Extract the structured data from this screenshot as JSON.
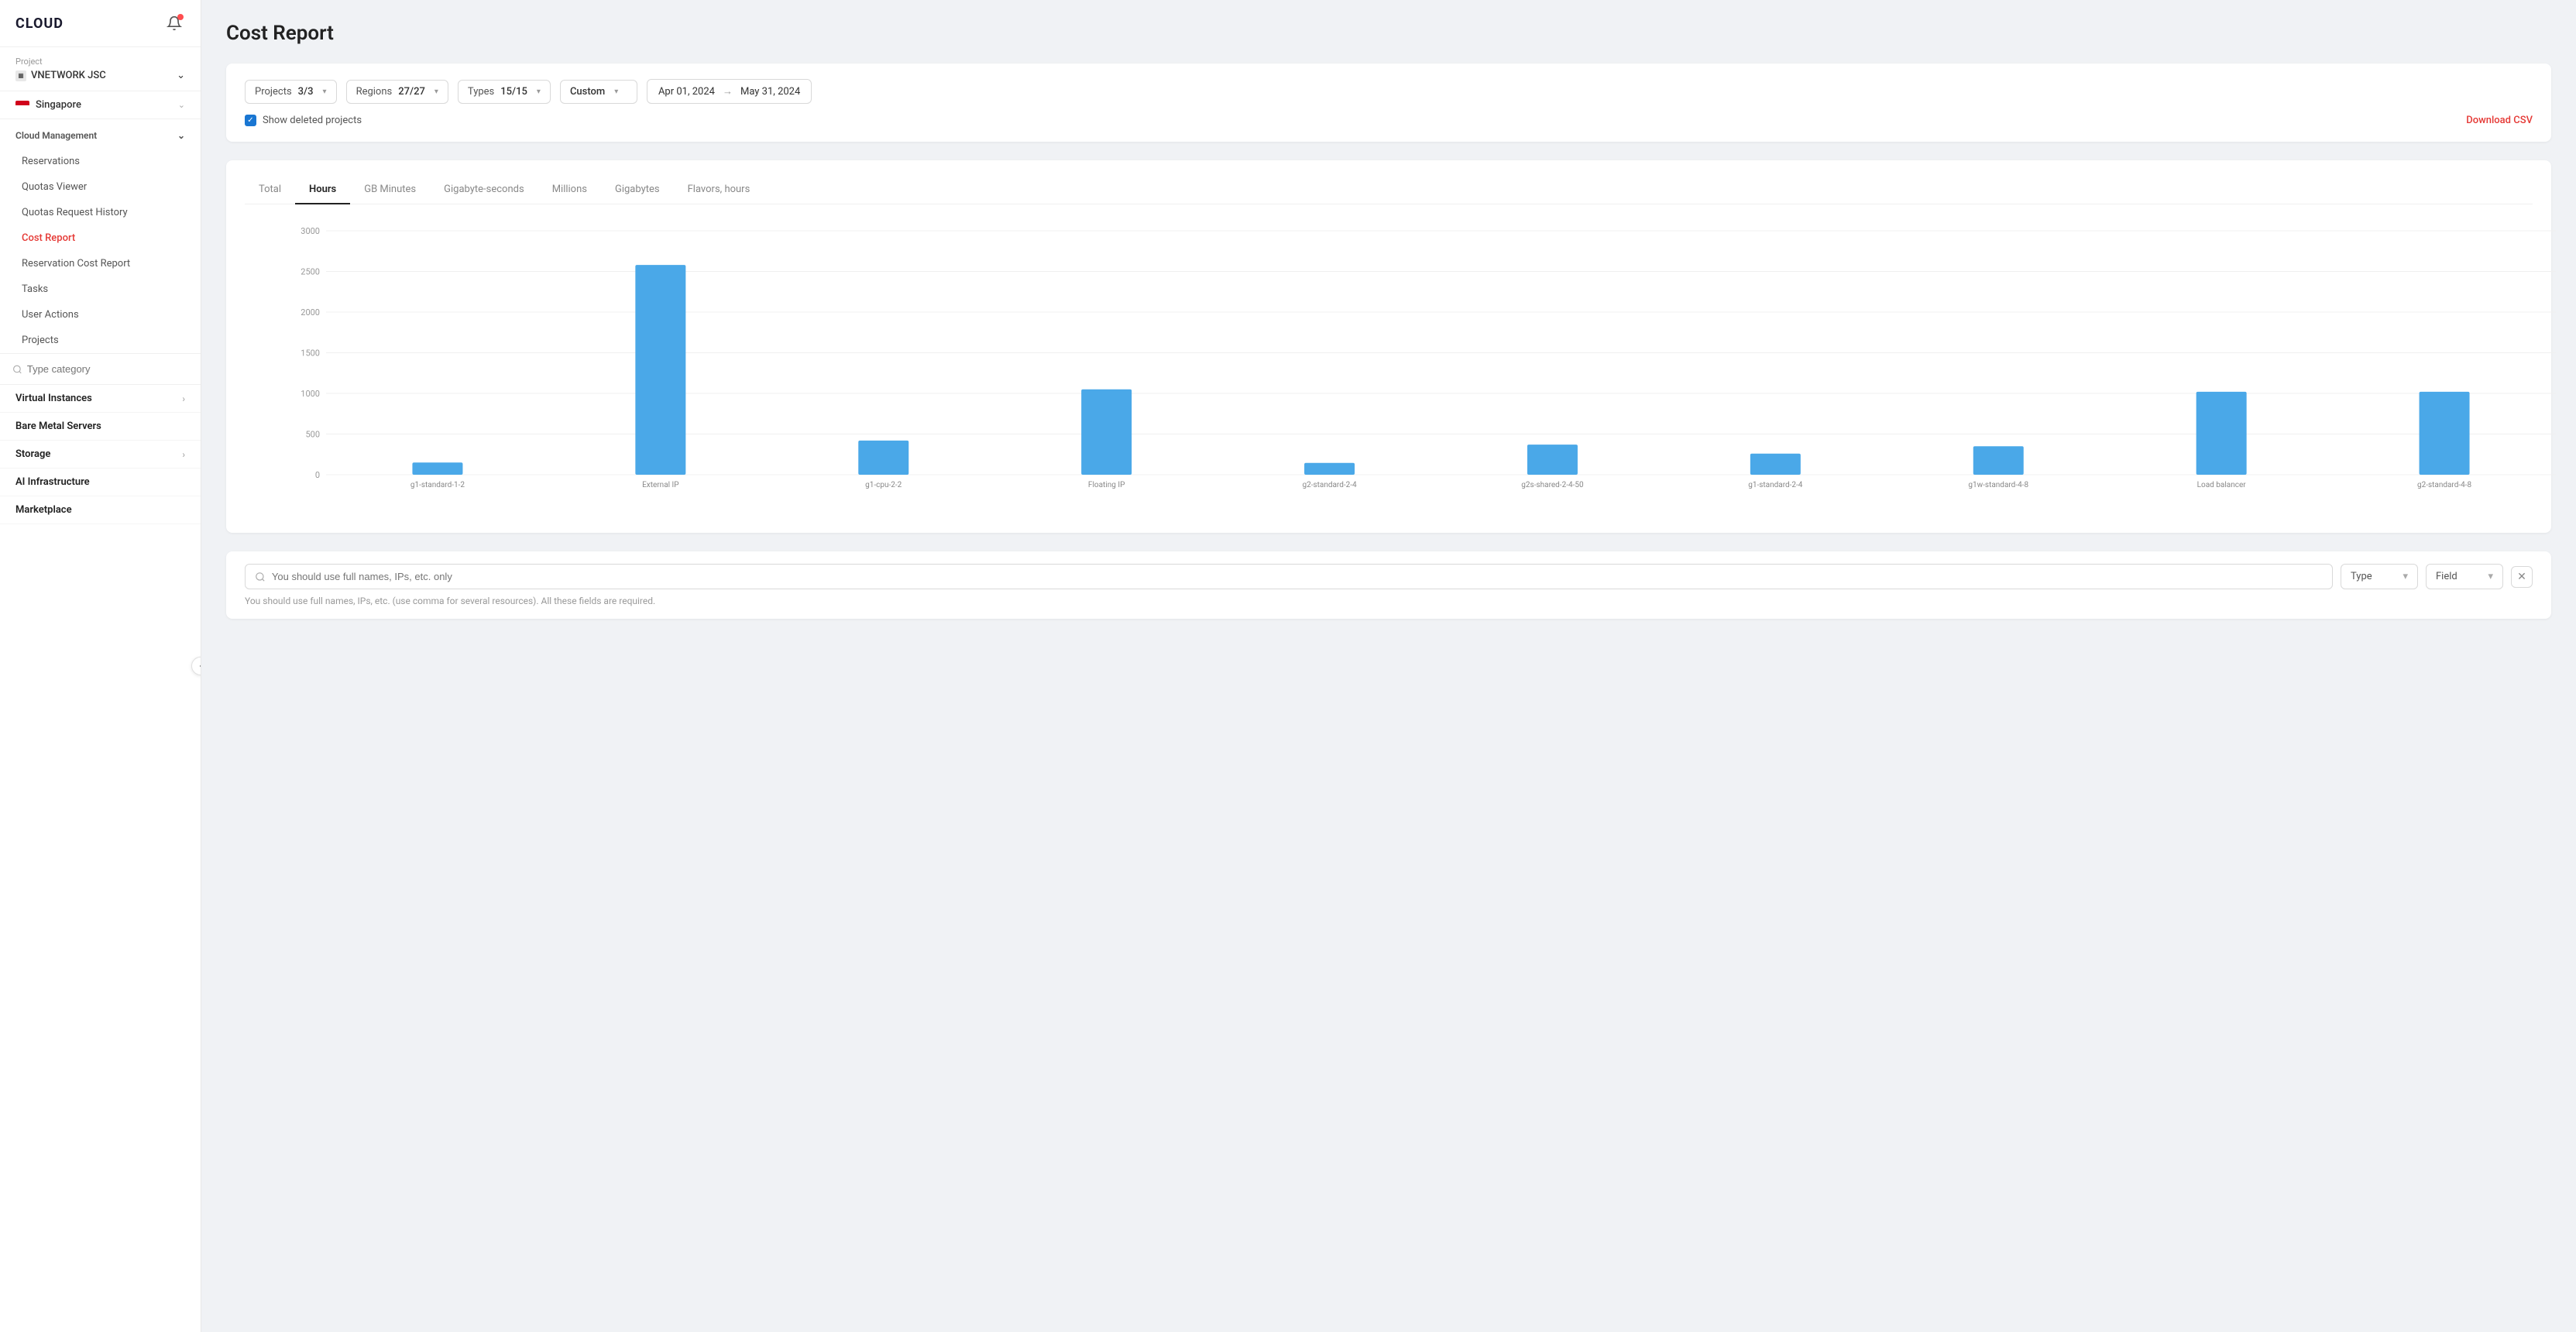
{
  "app": {
    "name": "CLOUD"
  },
  "sidebar": {
    "project_label": "Project",
    "project_name": "VNETWORK JSC",
    "region_name": "Singapore",
    "cloud_management_label": "Cloud Management",
    "nav_items": [
      {
        "id": "reservations",
        "label": "Reservations"
      },
      {
        "id": "quotas-viewer",
        "label": "Quotas Viewer"
      },
      {
        "id": "quotas-request-history",
        "label": "Quotas Request History"
      },
      {
        "id": "cost-report",
        "label": "Cost Report",
        "active": true
      },
      {
        "id": "reservation-cost-report",
        "label": "Reservation Cost Report"
      },
      {
        "id": "tasks",
        "label": "Tasks"
      },
      {
        "id": "user-actions",
        "label": "User Actions"
      },
      {
        "id": "projects",
        "label": "Projects"
      }
    ],
    "search_placeholder": "Type category",
    "categories": [
      {
        "id": "virtual-instances",
        "label": "Virtual Instances",
        "has_children": true
      },
      {
        "id": "bare-metal-servers",
        "label": "Bare Metal Servers",
        "has_children": false
      },
      {
        "id": "storage",
        "label": "Storage",
        "has_children": true
      },
      {
        "id": "ai-infrastructure",
        "label": "AI Infrastructure",
        "has_children": false
      },
      {
        "id": "marketplace",
        "label": "Marketplace",
        "has_children": false
      }
    ]
  },
  "main": {
    "page_title": "Cost Report",
    "filters": {
      "projects_label": "Projects",
      "projects_value": "3/3",
      "regions_label": "Regions",
      "regions_value": "27/27",
      "types_label": "Types",
      "types_value": "15/15",
      "period_label": "Custom",
      "date_from": "Apr 01, 2024",
      "date_to": "May 31, 2024",
      "show_deleted_label": "Show deleted projects",
      "download_csv_label": "Download CSV"
    },
    "tabs": [
      {
        "id": "total",
        "label": "Total"
      },
      {
        "id": "hours",
        "label": "Hours",
        "active": true
      },
      {
        "id": "gb-minutes",
        "label": "GB Minutes"
      },
      {
        "id": "gigabyte-seconds",
        "label": "Gigabyte-seconds"
      },
      {
        "id": "millions",
        "label": "Millions"
      },
      {
        "id": "gigabytes",
        "label": "Gigabytes"
      },
      {
        "id": "flavors-hours",
        "label": "Flavors, hours"
      }
    ],
    "chart": {
      "y_labels": [
        "0",
        "500",
        "1000",
        "1500",
        "2000",
        "2500",
        "3000"
      ],
      "bars": [
        {
          "label": "g1-standard-1-2",
          "value": 150,
          "max": 2700
        },
        {
          "label": "External IP",
          "value": 2580,
          "max": 2700
        },
        {
          "label": "g1-cpu-2-2",
          "value": 420,
          "max": 2700
        },
        {
          "label": "Floating IP",
          "value": 1050,
          "max": 2700
        },
        {
          "label": "g2-standard-2-4",
          "value": 145,
          "max": 2700
        },
        {
          "label": "g2s-shared-2-4-50",
          "value": 370,
          "max": 2700
        },
        {
          "label": "g1-standard-2-4",
          "value": 260,
          "max": 2700
        },
        {
          "label": "g1w-standard-4-8",
          "value": 350,
          "max": 2700
        },
        {
          "label": "Load balancer",
          "value": 1020,
          "max": 2700
        },
        {
          "label": "g2-standard-4-8",
          "value": 1020,
          "max": 2700
        }
      ]
    },
    "search": {
      "placeholder": "You should use full names, IPs, etc. only",
      "type_label": "Type",
      "field_label": "Field",
      "hint": "You should use full names, IPs, etc. (use comma for several resources). All these fields are required."
    }
  }
}
